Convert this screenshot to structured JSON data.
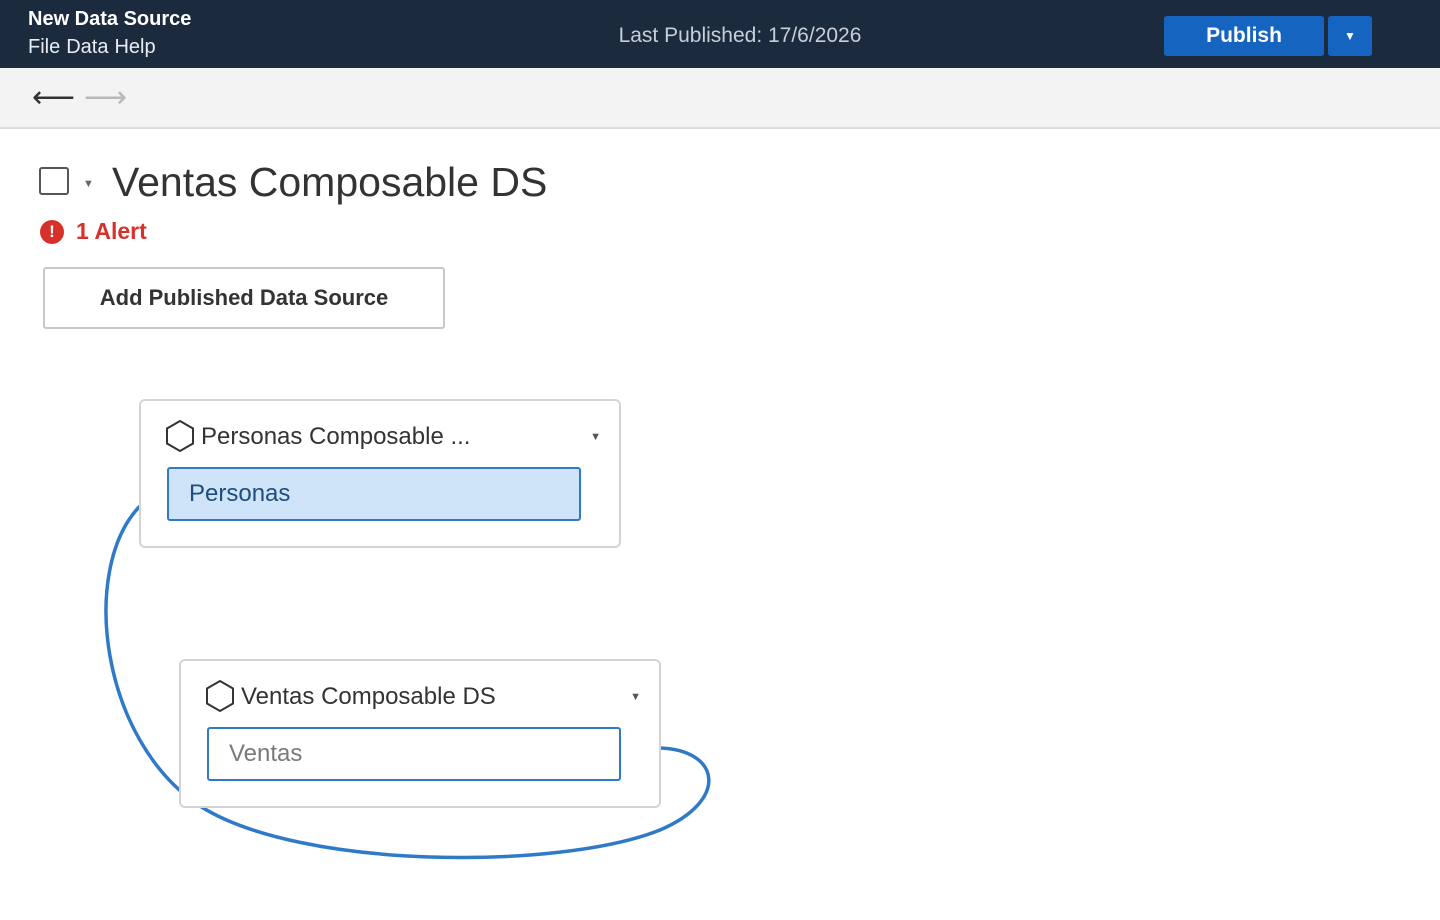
{
  "header": {
    "app_title": "New Data Source",
    "menu": [
      {
        "label": "File"
      },
      {
        "label": "Data"
      },
      {
        "label": "Help"
      }
    ],
    "last_published": "Last Published: 17/6/2026",
    "publish_label": "Publish",
    "publish_dropdown_icon": "caret-down-icon"
  },
  "nav": {
    "back_glyph": "⟵",
    "forward_glyph": "⟶"
  },
  "datasource": {
    "title": "Ventas Composable DS",
    "alert_icon_glyph": "!",
    "alert_text": "1 Alert",
    "add_button_label": "Add Published Data Source"
  },
  "cards": [
    {
      "name": "Personas Composable ...",
      "table": "Personas",
      "selected": true
    },
    {
      "name": "Ventas Composable DS",
      "table": "Ventas",
      "selected": false
    }
  ],
  "colors": {
    "header_bg": "#1c2a3e",
    "accent": "#1565c0",
    "alert": "#d6312b",
    "relationship_line": "#2f7ac7",
    "selected_fill": "#cfe4f8"
  }
}
